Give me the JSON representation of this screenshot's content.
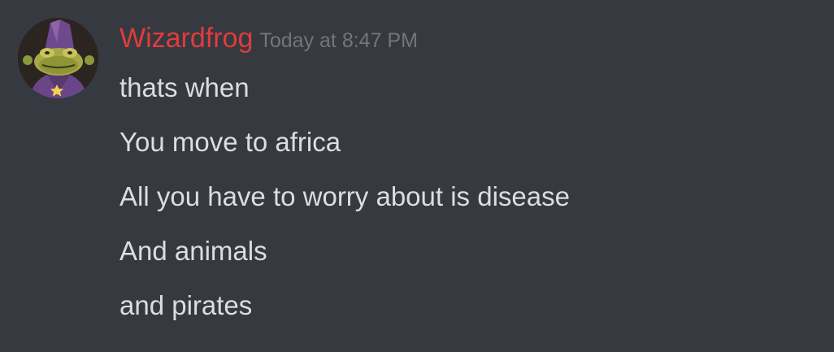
{
  "message": {
    "author": "Wizardfrog",
    "timestamp": "Today at 8:47 PM",
    "author_color": "#e03c3c",
    "avatar_icon": "wizard-frog-avatar",
    "lines": [
      "thats when",
      "You move to africa",
      "All you have to worry about is disease",
      "And animals",
      "and pirates"
    ]
  },
  "theme": {
    "background": "#36393f",
    "text": "#dcddde",
    "muted": "#72767d"
  }
}
